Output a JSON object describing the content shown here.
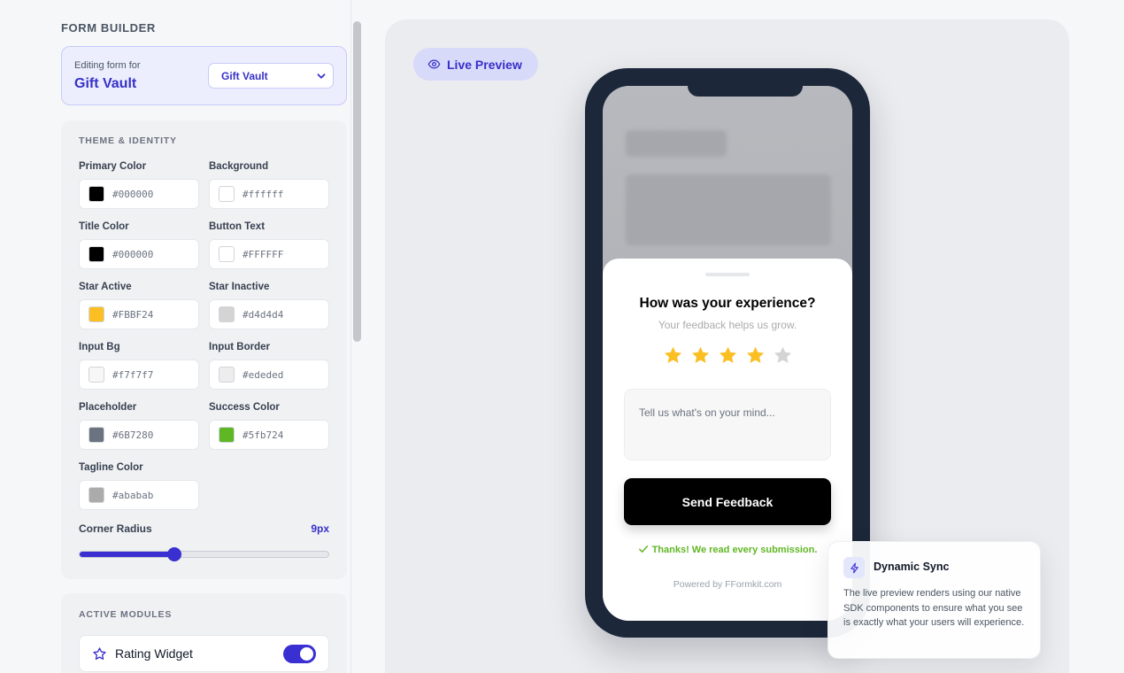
{
  "sidebar": {
    "heading": "FORM BUILDER",
    "editing": {
      "caption": "Editing form for",
      "app_name": "Gift Vault",
      "select_value": "Gift Vault"
    },
    "theme": {
      "title": "THEME & IDENTITY",
      "colors": [
        {
          "label": "Primary Color",
          "value": "#000000",
          "swatch": "#000000"
        },
        {
          "label": "Background",
          "value": "#ffffff",
          "swatch": "#ffffff"
        },
        {
          "label": "Title Color",
          "value": "#000000",
          "swatch": "#000000"
        },
        {
          "label": "Button Text",
          "value": "#FFFFFF",
          "swatch": "#FFFFFF"
        },
        {
          "label": "Star Active",
          "value": "#FBBF24",
          "swatch": "#FBBF24"
        },
        {
          "label": "Star Inactive",
          "value": "#d4d4d4",
          "swatch": "#d4d4d4"
        },
        {
          "label": "Input Bg",
          "value": "#f7f7f7",
          "swatch": "#f7f7f7"
        },
        {
          "label": "Input Border",
          "value": "#ededed",
          "swatch": "#ededed"
        },
        {
          "label": "Placeholder",
          "value": "#6B7280",
          "swatch": "#6B7280"
        },
        {
          "label": "Success Color",
          "value": "#5fb724",
          "swatch": "#5fb724"
        },
        {
          "label": "Tagline Color",
          "value": "#ababab",
          "swatch": "#ababab"
        }
      ],
      "radius": {
        "label": "Corner Radius",
        "value": "9px",
        "fraction": 0.38
      }
    },
    "modules": {
      "title": "ACTIVE MODULES",
      "items": [
        {
          "label": "Rating Widget",
          "icon": "star-outline-icon",
          "enabled": true
        }
      ]
    }
  },
  "preview": {
    "pill_label": "Live Preview",
    "pill_icon": "eye-icon",
    "form": {
      "title": "How was your experience?",
      "tagline": "Your feedback helps us grow.",
      "rating": 4,
      "max_rating": 5,
      "placeholder": "Tell us what's on your mind...",
      "button_label": "Send Feedback",
      "success_text": "Thanks! We read every submission.",
      "powered_by": "Powered by FFormkit.com"
    },
    "sync": {
      "title": "Dynamic Sync",
      "icon": "bolt-icon",
      "body": "The live preview renders using our native SDK components to ensure what you see is exactly what your users will experience."
    }
  },
  "colors": {
    "accent": "#3a2fd1",
    "accent_text": "#3730c9",
    "phone_frame": "#1c273a",
    "star_active": "#FBBF24",
    "star_inactive": "#d4d4d4"
  }
}
